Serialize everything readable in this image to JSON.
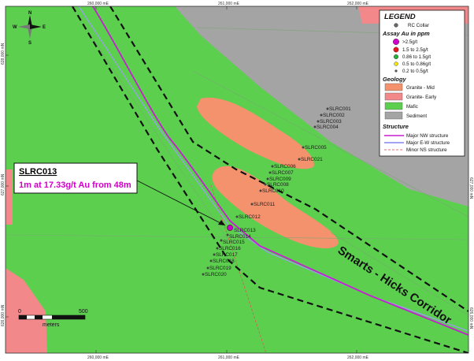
{
  "grid": {
    "top_labels": [
      "260,000 mE",
      "261,000 mE",
      "262,000 mE"
    ],
    "bottom_labels": [
      "260,000 mE",
      "261,000 mE",
      "262,000 mE"
    ],
    "left_labels": [
      "628,000 mN",
      "627,000 mN",
      "626,000 mN"
    ],
    "right_labels": [
      "627,000 mN",
      "626,000 mN"
    ]
  },
  "north_arrow": {
    "n": "N",
    "s": "S",
    "e": "E",
    "w": "W"
  },
  "legend": {
    "title": "LEGEND",
    "rc_collar": "RC Collar",
    "assay_title": "Assay Au in ppm",
    "assay_items": [
      {
        "label": ">2.5g/t",
        "color": "#d100c8"
      },
      {
        "label": "1.5 to 2.5g/t",
        "color": "#e8141e"
      },
      {
        "label": "0.86 to 1.5g/t",
        "color": "#25b03c"
      },
      {
        "label": "0.5 to 0.86g/t",
        "color": "#f2e600"
      },
      {
        "label": "0.2 to 0.5g/t",
        "color": "#555555"
      }
    ],
    "geology_title": "Geology",
    "geology_items": [
      {
        "label": "Granite - Mid",
        "color": "#f4926d"
      },
      {
        "label": "Granite- Early",
        "color": "#f2888a"
      },
      {
        "label": "Mafic",
        "color": "#5ccf4f"
      },
      {
        "label": "Sediment",
        "color": "#a4a4a4"
      }
    ],
    "structure_title": "Structure",
    "structure_items": [
      {
        "label": "Major NW structure",
        "color": "#c51fcf"
      },
      {
        "label": "Major E-W structure",
        "color": "#6d6df0"
      },
      {
        "label": "Minor NS structure",
        "color": "#e07070"
      }
    ]
  },
  "drillholes": [
    "SLRC001",
    "SLRC002",
    "SLRC003",
    "SLRC004",
    "SLRC005",
    "SLRC021",
    "SLRC006",
    "SLRC007",
    "SLRC009",
    "SLRC008",
    "SLRC010",
    "SLRC011",
    "SLRC012",
    "SLRC013",
    "SLRC014",
    "SLRC015",
    "SLRC016",
    "SLRC017",
    "SLRC018",
    "SLRC019",
    "SLRC020"
  ],
  "callout": {
    "hole": "SLRC013",
    "result": "1m at 17.33g/t Au from 48m"
  },
  "corridor_label": "Smarts - Hicks Corridor",
  "scale": {
    "zero": "0",
    "max": "500",
    "unit": "meters"
  }
}
